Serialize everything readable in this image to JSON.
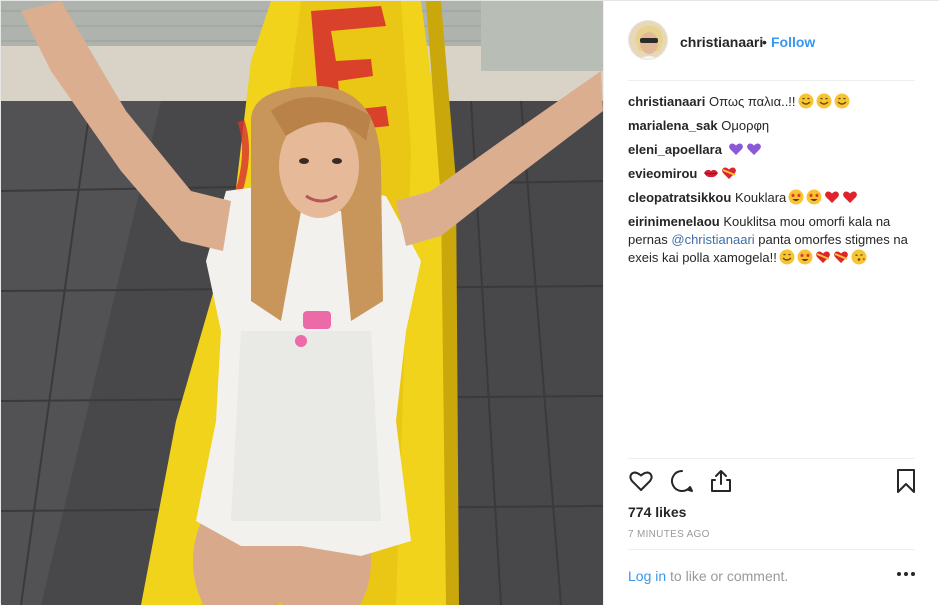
{
  "post": {
    "author": "christianaari",
    "follow_label": "Follow",
    "separator": "•"
  },
  "comments": [
    {
      "user": "christianaari",
      "text": "Οπως παλια..!!",
      "emojis": [
        "smile-face",
        "smile-face",
        "smile-face"
      ]
    },
    {
      "user": "marialena_sak",
      "text": "Ομορφη",
      "emojis": []
    },
    {
      "user": "eleni_apoellara",
      "text": "",
      "emojis": [
        "purple-heart",
        "purple-heart"
      ]
    },
    {
      "user": "evieomirou",
      "text": "",
      "emojis": [
        "kiss-lips",
        "heart-on-ribbon"
      ]
    },
    {
      "user": "cleopatratsikkou",
      "text": "Kouklara",
      "emojis": [
        "star-struck-face",
        "star-struck-face",
        "red-heart",
        "red-heart"
      ]
    },
    {
      "user": "eirinimenelaou",
      "text_before": "Kouklitsa mou omorfi kala na pernas ",
      "mention": "@christianaari",
      "text_after": " panta omorfes stigmes na exeis kai polla xamogela!!",
      "emojis": [
        "smile-face",
        "star-struck-face",
        "heart-on-ribbon",
        "heart-on-ribbon",
        "kiss-face"
      ]
    }
  ],
  "actions": {
    "like_icon": "heart-outline-icon",
    "comment_icon": "comment-bubble-icon",
    "share_icon": "share-upload-icon",
    "save_icon": "bookmark-icon"
  },
  "likes_text": "774 likes",
  "time_text": "7 MINUTES AGO",
  "footer": {
    "login_label": "Log in",
    "rest_text": " to like or comment.",
    "more_icon": "more-options-icon"
  },
  "colors": {
    "link": "#3897f0",
    "mention": "#3d6ea8",
    "muted": "#999999",
    "text": "#262626"
  }
}
